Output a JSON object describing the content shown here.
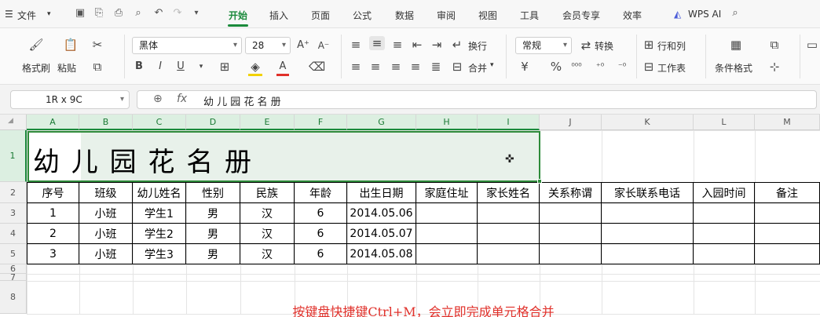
{
  "menubar": {
    "file_label": "文件",
    "tabs": [
      "开始",
      "插入",
      "页面",
      "公式",
      "数据",
      "审阅",
      "视图",
      "工具",
      "会员专享",
      "效率"
    ],
    "wps_ai": "WPS AI"
  },
  "ribbon": {
    "format_painter": "格式刷",
    "paste": "粘贴",
    "font_name": "黑体",
    "font_size": "28",
    "wrap": "换行",
    "merge": "合并",
    "number_format": "常规",
    "convert": "转换",
    "rows_cols": "行和列",
    "worksheet": "工作表",
    "cond_format": "条件格式"
  },
  "formula_bar": {
    "name_box": "1R x 9C",
    "formula": "幼 儿 园 花 名 册"
  },
  "grid": {
    "columns": [
      "A",
      "B",
      "C",
      "D",
      "E",
      "F",
      "G",
      "H",
      "I",
      "J",
      "K",
      "L",
      "M"
    ],
    "rows": [
      "1",
      "2",
      "3",
      "4",
      "5",
      "6",
      "7",
      "8"
    ],
    "title": "幼 儿 园 花 名 册",
    "headers": [
      "序号",
      "班级",
      "幼儿姓名",
      "性别",
      "民族",
      "年龄",
      "出生日期",
      "家庭住址",
      "家长姓名",
      "关系称谓",
      "家长联系电话",
      "入园时间",
      "备注"
    ],
    "data": [
      [
        "1",
        "小班",
        "学生1",
        "男",
        "汉",
        "6",
        "2014.05.06"
      ],
      [
        "2",
        "小班",
        "学生2",
        "男",
        "汉",
        "6",
        "2014.05.07"
      ],
      [
        "3",
        "小班",
        "学生3",
        "男",
        "汉",
        "6",
        "2014.05.08"
      ]
    ],
    "note": "按键盘快捷键Ctrl+M，会立即完成单元格合并"
  },
  "colors": {
    "accent": "#1a8a3b",
    "note_text": "#e0302a"
  }
}
